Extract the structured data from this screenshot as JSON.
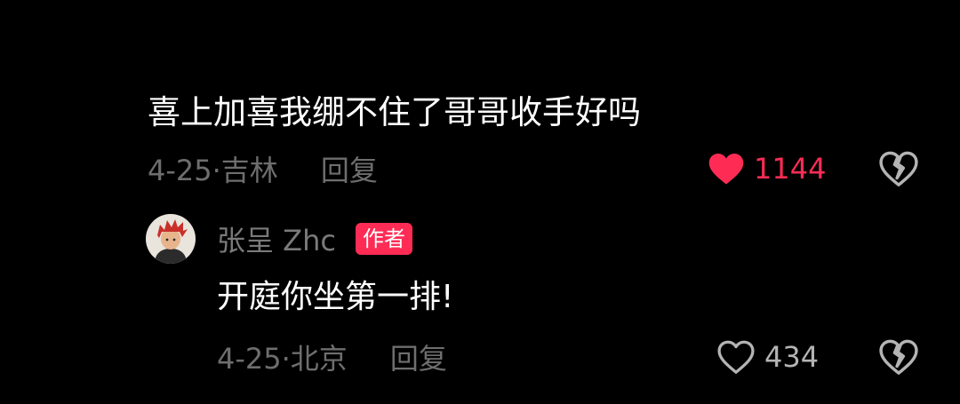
{
  "colors": {
    "background": "#000000",
    "text_primary": "#ffffff",
    "text_secondary": "#6e6e6e",
    "accent": "#fe2c55",
    "icon_outline": "#b4b4b4"
  },
  "comment": {
    "text": "喜上加喜我绷不住了哥哥收手好吗",
    "meta": "4-25·吉林",
    "reply_label": "回复",
    "likes": "1144",
    "liked": true,
    "like_icon": "heart-filled-icon",
    "dislike_icon": "broken-heart-icon"
  },
  "reply": {
    "avatar_icon": "avatar-red-hair",
    "author_name": "张呈 Zhc",
    "author_badge": "作者",
    "text": "开庭你坐第一排!",
    "meta": "4-25·北京",
    "reply_label": "回复",
    "likes": "434",
    "liked": false,
    "like_icon": "heart-outline-icon",
    "dislike_icon": "broken-heart-icon"
  }
}
